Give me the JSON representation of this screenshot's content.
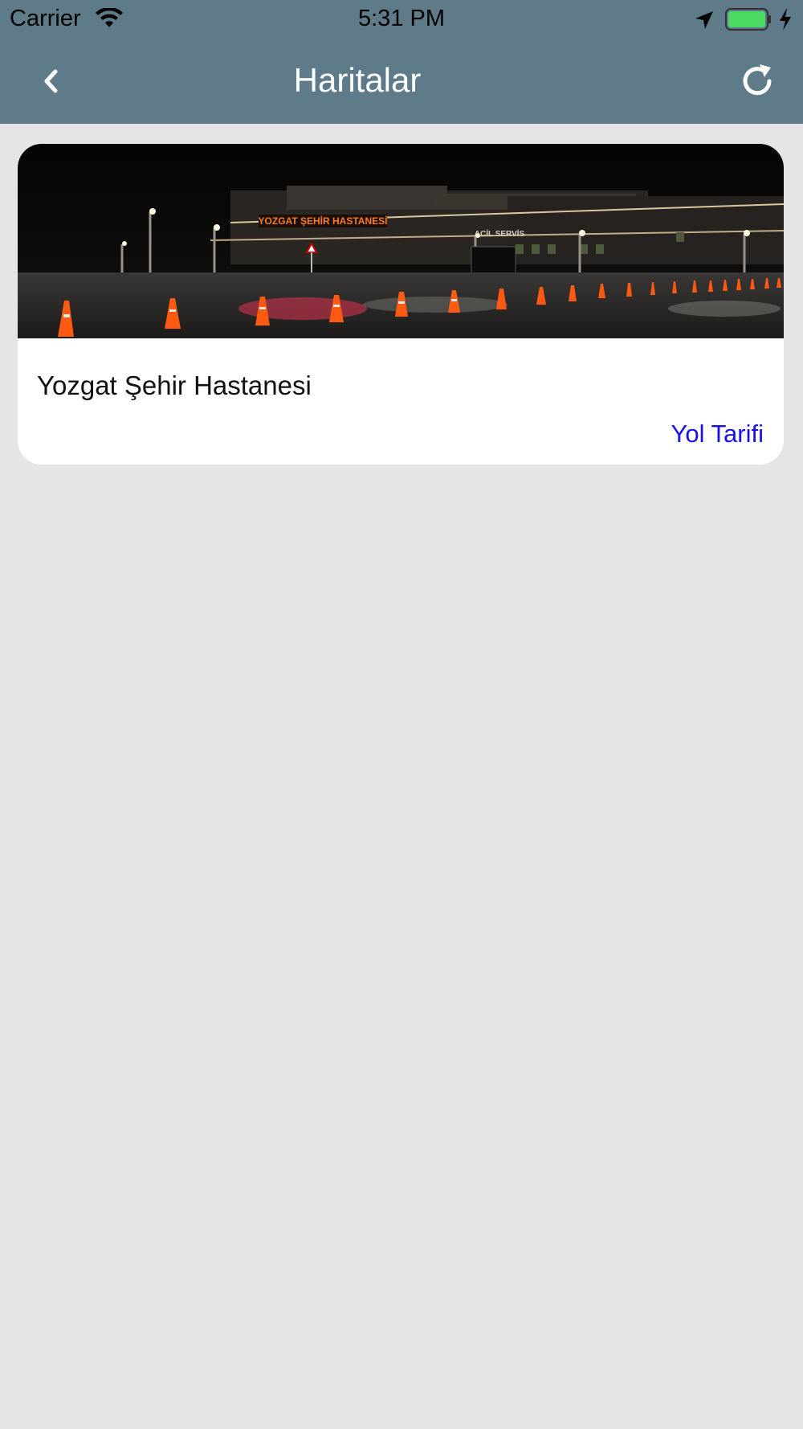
{
  "status_bar": {
    "carrier": "Carrier",
    "time": "5:31 PM",
    "icons": [
      "wifi-icon",
      "location-arrow-icon",
      "battery-icon",
      "charging-bolt-icon"
    ],
    "battery_color": "#4cd964"
  },
  "nav": {
    "title": "Haritalar",
    "back_icon": "chevron-left-icon",
    "refresh_icon": "refresh-icon",
    "bar_color": "#5f7b89"
  },
  "cards": [
    {
      "title": "Yozgat Şehir Hastanesi",
      "link_label": "Yol Tarifi",
      "image_sign_text": "YOZGAT ŞEHİR HASTANESİ",
      "image_sign_text_2": "ACİL SERVİS",
      "link_color": "#1a10e6"
    }
  ]
}
